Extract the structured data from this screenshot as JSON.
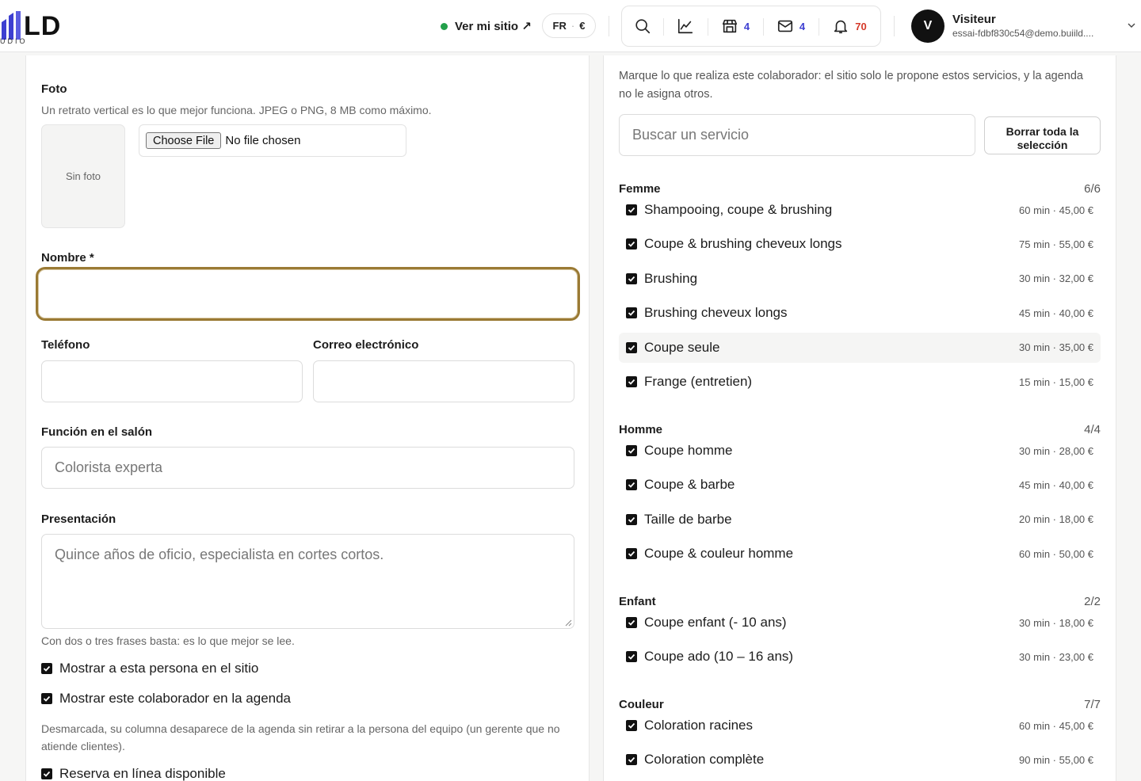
{
  "brand": {
    "word": "LD",
    "sub": "UDIO"
  },
  "header": {
    "site_link": "Ver mi sitio ↗",
    "lang": "FR",
    "currency": "€",
    "badges": {
      "shop": "4",
      "mail": "4",
      "bell": "70"
    },
    "user": {
      "initial": "V",
      "name": "Visiteur",
      "email": "essai-fdbf830c54@demo.buiild...."
    }
  },
  "colors": {
    "accent_focus": "#9a7a34",
    "status_online": "#22a04a",
    "badge_blue": "#3d3fd1",
    "badge_red": "#d53a2a"
  },
  "form": {
    "photo": {
      "label": "Foto",
      "help": "Un retrato vertical es lo que mejor funciona. JPEG o PNG, 8 MB como máximo.",
      "placeholder": "Sin foto",
      "choose_file": "Choose File",
      "no_file": "No file chosen"
    },
    "name": {
      "label": "Nombre *",
      "value": ""
    },
    "phone": {
      "label": "Teléfono",
      "value": ""
    },
    "email": {
      "label": "Correo electrónico",
      "value": ""
    },
    "role": {
      "label": "Función en el salón",
      "placeholder": "Colorista experta"
    },
    "bio": {
      "label": "Presentación",
      "placeholder": "Quince años de oficio, especialista en cortes cortos.",
      "help": "Con dos o tres frases basta: es lo que mejor se lee."
    },
    "checks": {
      "show_site": "Mostrar a esta persona en el sitio",
      "show_agenda": "Mostrar este colaborador en la agenda",
      "agenda_help": "Desmarcada, su columna desaparece de la agenda sin retirar a la persona del equipo (un gerente que no atiende clientes).",
      "online_booking": "Reserva en línea disponible"
    }
  },
  "services": {
    "intro": "Marque lo que realiza este colaborador: el sitio solo le propone estos servicios, y la agenda no le asigna otros.",
    "search_placeholder": "Buscar un servicio",
    "clear_label": "Borrar toda la selección",
    "groups": [
      {
        "title": "Femme",
        "count": "6/6",
        "items": [
          {
            "name": "Shampooing, coupe & brushing",
            "meta": "60 min · 45,00 €"
          },
          {
            "name": "Coupe & brushing cheveux longs",
            "meta": "75 min · 55,00 €"
          },
          {
            "name": "Brushing",
            "meta": "30 min · 32,00 €"
          },
          {
            "name": "Brushing cheveux longs",
            "meta": "45 min · 40,00 €"
          },
          {
            "name": "Coupe seule",
            "meta": "30 min · 35,00 €"
          },
          {
            "name": "Frange (entretien)",
            "meta": "15 min · 15,00 €"
          }
        ]
      },
      {
        "title": "Homme",
        "count": "4/4",
        "items": [
          {
            "name": "Coupe homme",
            "meta": "30 min · 28,00 €"
          },
          {
            "name": "Coupe & barbe",
            "meta": "45 min · 40,00 €"
          },
          {
            "name": "Taille de barbe",
            "meta": "20 min · 18,00 €"
          },
          {
            "name": "Coupe & couleur homme",
            "meta": "60 min · 50,00 €"
          }
        ]
      },
      {
        "title": "Enfant",
        "count": "2/2",
        "items": [
          {
            "name": "Coupe enfant (- 10 ans)",
            "meta": "30 min · 18,00 €"
          },
          {
            "name": "Coupe ado (10 – 16 ans)",
            "meta": "30 min · 23,00 €"
          }
        ]
      },
      {
        "title": "Couleur",
        "count": "7/7",
        "items": [
          {
            "name": "Coloration racines",
            "meta": "60 min · 45,00 €"
          },
          {
            "name": "Coloration complète",
            "meta": "90 min · 55,00 €"
          }
        ]
      }
    ]
  }
}
